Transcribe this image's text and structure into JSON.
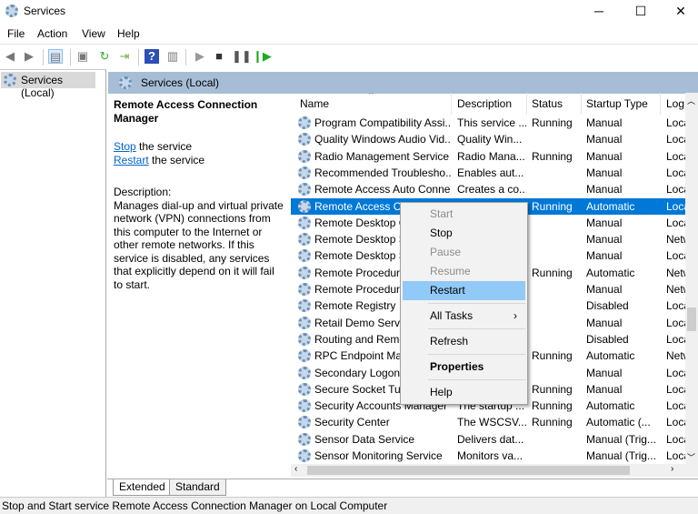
{
  "window": {
    "title": "Services",
    "minimize": "─",
    "maximize": "☐",
    "close": "✕"
  },
  "menu": [
    "File",
    "Action",
    "View",
    "Help"
  ],
  "tree": {
    "root": "Services (Local)"
  },
  "header": {
    "title": "Services (Local)"
  },
  "details": {
    "service_name": "Remote Access Connection Manager",
    "stop_link": "Stop",
    "stop_suffix": " the service",
    "restart_link": "Restart",
    "restart_suffix": " the service",
    "description_label": "Description:",
    "description": "Manages dial-up and virtual private network (VPN) connections from this computer to the Internet or other remote networks. If this service is disabled, any services that explicitly depend on it will fail to start."
  },
  "columns": [
    "Name",
    "Description",
    "Status",
    "Startup Type",
    "Log"
  ],
  "rows": [
    [
      "Program Compatibility Assi...",
      "This service ...",
      "Running",
      "Manual",
      "Loca"
    ],
    [
      "Quality Windows Audio Vid...",
      "Quality Win...",
      "",
      "Manual",
      "Loca"
    ],
    [
      "Radio Management Service",
      "Radio Mana...",
      "Running",
      "Manual",
      "Loca"
    ],
    [
      "Recommended Troublesho...",
      "Enables aut...",
      "",
      "Manual",
      "Loca"
    ],
    [
      "Remote Access Auto Conne...",
      "Creates a co...",
      "",
      "Manual",
      "Loca"
    ],
    [
      "Remote Access Co",
      "",
      "Running",
      "Automatic",
      "Loca"
    ],
    [
      "Remote Desktop C",
      "",
      "",
      "Manual",
      "Loca"
    ],
    [
      "Remote Desktop S",
      "",
      "",
      "Manual",
      "Netw"
    ],
    [
      "Remote Desktop S",
      "",
      "",
      "Manual",
      "Loca"
    ],
    [
      "Remote Procedure",
      "",
      "Running",
      "Automatic",
      "Netw"
    ],
    [
      "Remote Procedure",
      "",
      "",
      "Manual",
      "Netw"
    ],
    [
      "Remote Registry",
      "",
      "",
      "Disabled",
      "Loca"
    ],
    [
      "Retail Demo Servic",
      "",
      "",
      "Manual",
      "Loca"
    ],
    [
      "Routing and Remo",
      "",
      "",
      "Disabled",
      "Loca"
    ],
    [
      "RPC Endpoint Map",
      "",
      "Running",
      "Automatic",
      "Netw"
    ],
    [
      "Secondary Logon",
      "",
      "",
      "Manual",
      "Loca"
    ],
    [
      "Secure Socket Tun",
      "",
      "Running",
      "Manual",
      "Loca"
    ],
    [
      "Security Accounts Manager",
      "The startup ...",
      "Running",
      "Automatic",
      "Loca"
    ],
    [
      "Security Center",
      "The WSCSV...",
      "Running",
      "Automatic (...",
      "Loca"
    ],
    [
      "Sensor Data Service",
      "Delivers dat...",
      "",
      "Manual (Trig...",
      "Loca"
    ],
    [
      "Sensor Monitoring Service",
      "Monitors va...",
      "",
      "Manual (Trig...",
      "Loca"
    ]
  ],
  "selected_row": 5,
  "context_menu": {
    "start": "Start",
    "stop": "Stop",
    "pause": "Pause",
    "resume": "Resume",
    "restart": "Restart",
    "all_tasks": "All Tasks",
    "submenu_arrow": "›",
    "refresh": "Refresh",
    "properties": "Properties",
    "help": "Help"
  },
  "tabs": [
    "Extended",
    "Standard"
  ],
  "status_bar": "Stop and Start service Remote Access Connection Manager on Local Computer",
  "colors": {
    "selection": "#0078d7",
    "menu_highlight": "#91c9f7",
    "header_band": "#a7bdd6",
    "link": "#0066cc"
  }
}
